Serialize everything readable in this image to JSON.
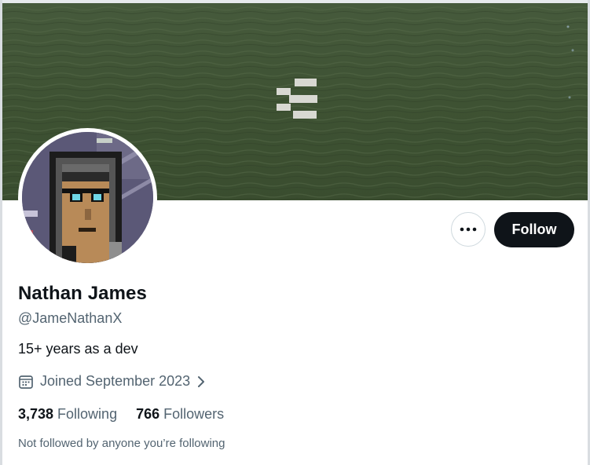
{
  "profile": {
    "display_name": "Nathan James",
    "handle": "@JameNathanX",
    "bio": "15+ years as a dev",
    "joined": "Joined September 2023"
  },
  "actions": {
    "follow_label": "Follow",
    "more_icon": "more-horizontal-icon"
  },
  "stats": {
    "following_count": "3,738",
    "following_label": "Following",
    "followers_count": "766",
    "followers_label": "Followers"
  },
  "followed_by_note": "Not followed by anyone you’re following",
  "colors": {
    "primary_text": "#0f1419",
    "secondary_text": "#536471",
    "follow_button_bg": "#0f1419",
    "banner_water": "#3f5032"
  },
  "icons": {
    "calendar": "calendar-icon",
    "chevron": "chevron-right-icon",
    "banner_logo": "banner-logo-icon"
  }
}
